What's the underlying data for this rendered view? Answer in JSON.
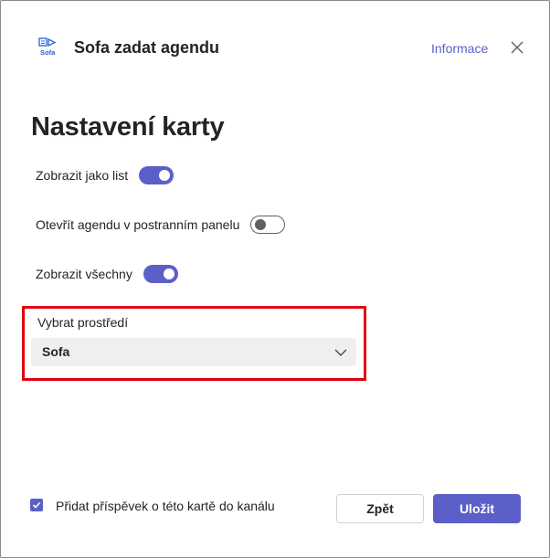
{
  "header": {
    "app_title": "Sofa zadat agendu",
    "logo_text": "Sofa",
    "info_link": "Informace"
  },
  "page": {
    "title": "Nastavení karty"
  },
  "settings": {
    "toggles": [
      {
        "label": "Zobrazit jako list",
        "on": true
      },
      {
        "label": "Otevřít agendu v postranním panelu",
        "on": false
      },
      {
        "label": "Zobrazit všechny",
        "on": true
      }
    ],
    "environment_label": "Vybrat prostředí",
    "environment_value": "Sofa"
  },
  "footer": {
    "post_checkbox_label": "Přidat příspěvek o této kartě do kanálu",
    "post_checkbox_checked": true,
    "back_label": "Zpět",
    "save_label": "Uložit"
  },
  "colors": {
    "accent": "#5b5fc7",
    "highlight_box": "#e3000f",
    "select_bg": "#f0efee"
  }
}
